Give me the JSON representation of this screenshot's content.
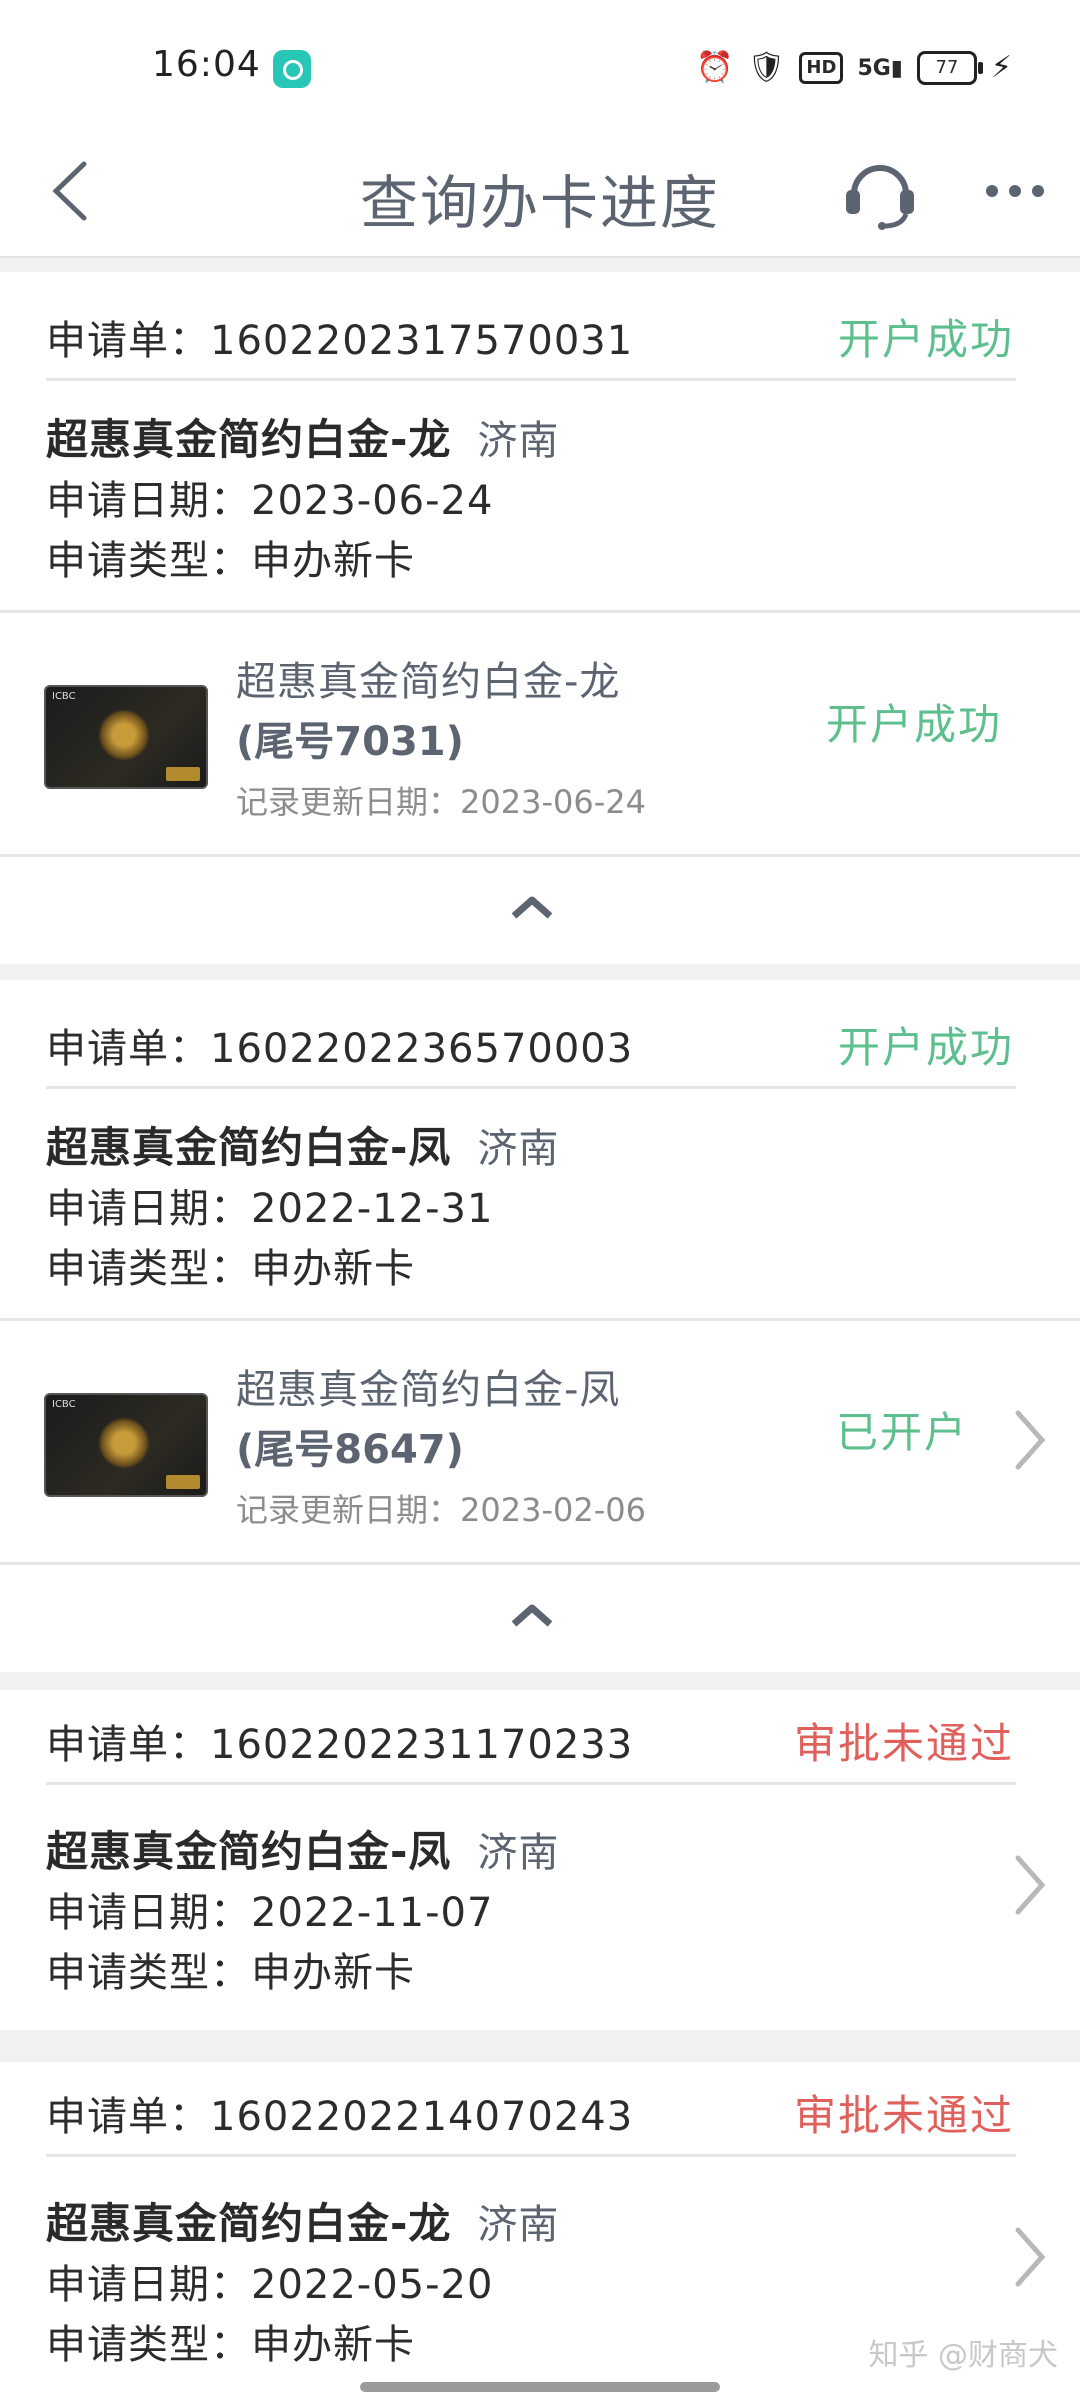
{
  "status_bar": {
    "time": "16:04",
    "battery": "77"
  },
  "nav": {
    "title": "查询办卡进度"
  },
  "applications": [
    {
      "order_label": "申请单：1602202317570031",
      "status": "开户成功",
      "product": "超惠真金简约白金-龙",
      "city": "济南",
      "date_label": "申请日期：2023-06-24",
      "type_label": "申请类型：申办新卡",
      "card": {
        "name": "超惠真金简约白金-龙",
        "tail": "(尾号7031)",
        "updated": "记录更新日期：2023-06-24",
        "status": "开户成功"
      }
    },
    {
      "order_label": "申请单：1602202236570003",
      "status": "开户成功",
      "product": "超惠真金简约白金-凤",
      "city": "济南",
      "date_label": "申请日期：2022-12-31",
      "type_label": "申请类型：申办新卡",
      "card": {
        "name": "超惠真金简约白金-凤",
        "tail": "(尾号8647)",
        "updated": "记录更新日期：2023-02-06",
        "status": "已开户"
      }
    },
    {
      "order_label": "申请单：1602202231170233",
      "status": "审批未通过",
      "product": "超惠真金简约白金-凤",
      "city": "济南",
      "date_label": "申请日期：2022-11-07",
      "type_label": "申请类型：申办新卡"
    },
    {
      "order_label": "申请单：1602202214070243",
      "status": "审批未通过",
      "product": "超惠真金简约白金-龙",
      "city": "济南",
      "date_label": "申请日期：2022-05-20",
      "type_label": "申请类型：申办新卡"
    }
  ],
  "card_bank": "ICBC",
  "watermark": "知乎 @财商犬",
  "colors": {
    "success": "#5dbf8e",
    "fail": "#e0605b",
    "title": "#5b6470"
  }
}
